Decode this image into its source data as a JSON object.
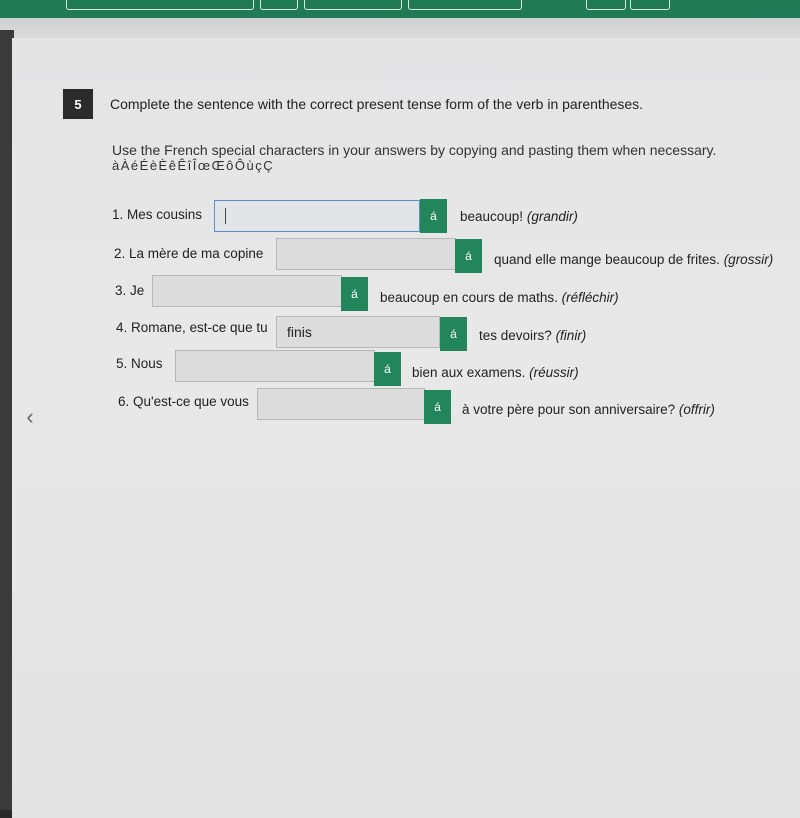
{
  "question": {
    "number": "5",
    "instruction": "Complete the sentence with the correct present tense form of the verb in parentheses.",
    "sub_instruction": "Use the French special characters in your answers by copying and pasting them when necessary.",
    "special_characters": [
      "à",
      "À",
      "é",
      "É",
      "è",
      "È",
      "ê",
      "Ê",
      "î",
      "Î",
      "œ",
      "Œ",
      "ô",
      "Ô",
      "ù",
      "ç",
      "Ç"
    ]
  },
  "items": [
    {
      "prefix": "1. Mes cousins",
      "value": "",
      "active": true,
      "accent_label": "á",
      "suffix": "beaucoup!",
      "verb": "(grandir)"
    },
    {
      "prefix": "2. La mère de ma copine",
      "value": "",
      "active": false,
      "accent_label": "á",
      "suffix": "quand elle mange beaucoup de frites.",
      "verb": "(grossir)"
    },
    {
      "prefix": "3. Je",
      "value": "",
      "active": false,
      "accent_label": "á",
      "suffix": "beaucoup en cours de maths.",
      "verb": "(réfléchir)"
    },
    {
      "prefix": "4. Romane, est-ce que tu",
      "value": "finis",
      "active": false,
      "accent_label": "á",
      "suffix": "tes devoirs?",
      "verb": "(finir)"
    },
    {
      "prefix": "5. Nous",
      "value": "",
      "active": false,
      "accent_label": "á",
      "suffix": "bien aux examens.",
      "verb": "(réussir)"
    },
    {
      "prefix": "6. Qu'est-ce que vous",
      "value": "",
      "active": false,
      "accent_label": "á",
      "suffix": "à votre père pour son anniversaire?",
      "verb": "(offrir)"
    }
  ],
  "navigation": {
    "prev_icon": "chevron-left-icon",
    "prev_glyph": "‹"
  },
  "colors": {
    "brand_green": "#1f7a55",
    "accent_button": "#23855c",
    "number_badge": "#2b2b2b"
  }
}
